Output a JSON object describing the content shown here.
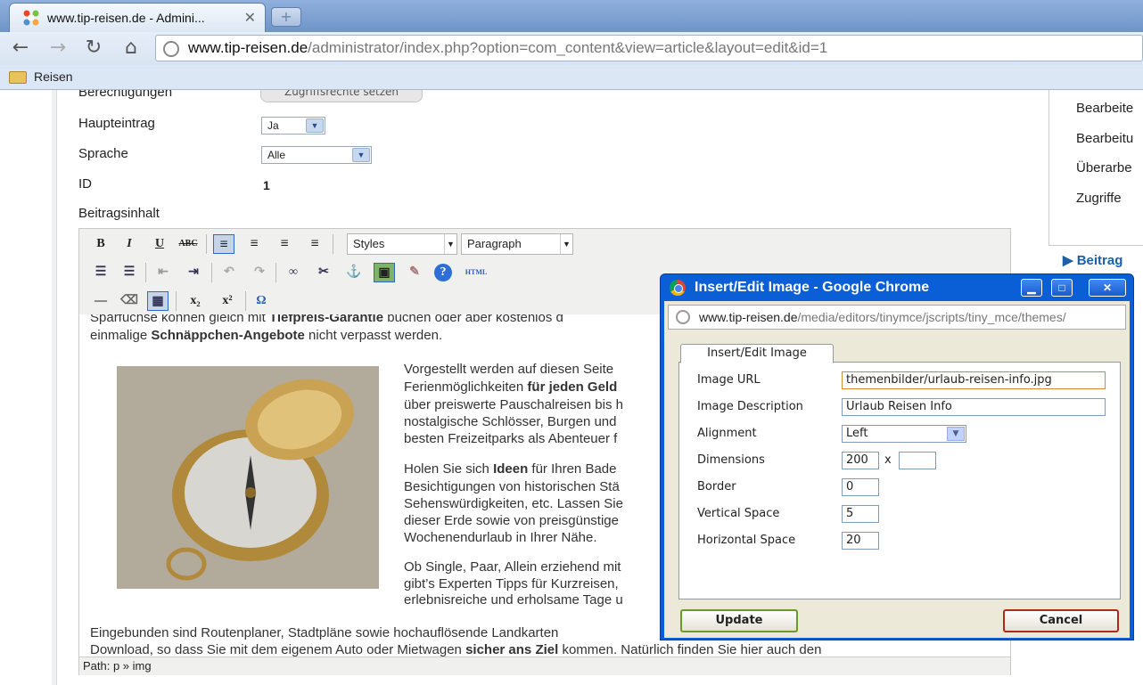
{
  "browser": {
    "tab_title": "www.tip-reisen.de - Admini...",
    "url_host": "www.tip-reisen.de",
    "url_path": "/administrator/index.php?option=com_content&view=article&layout=edit&id=1",
    "bookmark": "Reisen"
  },
  "form": {
    "permissions_label": "Berechtigungen",
    "permissions_button": "Zugriffsrechte setzen",
    "featured_label": "Haupteintrag",
    "featured_value": "Ja",
    "language_label": "Sprache",
    "language_value": "Alle",
    "id_label": "ID",
    "id_value": "1",
    "content_label": "Beitragsinhalt"
  },
  "editor": {
    "styles_select": "Styles",
    "format_select": "Paragraph",
    "html_button": "HTML",
    "path": "Path: p » img",
    "content": {
      "line1_a": "Sparfüchse können gleich mit ",
      "line1_b": "Tiefpreis-Garantie",
      "line1_c": " buchen oder aber kostenlos d",
      "line2_a": "einmalige ",
      "line2_b": "Schnäppchen-Angebote",
      "line2_c": " nicht verpasst werden.",
      "p1_1": "Vorgestellt werden auf diesen Seite",
      "p1_2a": "Ferienmöglichkeiten ",
      "p1_2b": "für jeden Geld",
      "p1_3": "über preiswerte Pauschalreisen bis h",
      "p1_4": "nostalgische Schlösser, Burgen und",
      "p1_5": "besten Freizeitparks als Abenteuer f",
      "p2_1a": "Holen Sie sich ",
      "p2_1b": "Ideen",
      "p2_1c": " für Ihren Bade",
      "p2_2": "Besichtigungen von historischen Stä",
      "p2_3": "Sehenswürdigkeiten, etc. Lassen Sie",
      "p2_4": "dieser Erde sowie von preisgünstige",
      "p2_5": "Wochenendurlaub in Ihrer Nähe.",
      "p3_1": "Ob Single, Paar, Allein erziehend mit",
      "p3_2": "gibt’s Experten Tipps für Kurzreisen,",
      "p3_3": "erlebnisreiche und erholsame Tage u",
      "p4_1": "Eingebunden sind Routenplaner, Stadtpläne sowie hochauflösende Landkarten",
      "p4_2a": "Download, so dass Sie mit dem eigenem Auto oder Mietwagen ",
      "p4_2b": "sicher ans Ziel",
      "p4_2c": " kommen. Natürlich finden Sie hier auch den"
    }
  },
  "right_column": {
    "items": [
      "Bearbeite",
      "Bearbeitu",
      "Überarbe",
      "Zugriffe"
    ],
    "section": "Beitrag"
  },
  "dialog": {
    "title": "Insert/Edit Image - Google Chrome",
    "url_host": "www.tip-reisen.de",
    "url_path": "/media/editors/tinymce/jscripts/tiny_mce/themes/",
    "tab": "Insert/Edit Image",
    "image_url_label": "Image URL",
    "image_url_value": "themenbilder/urlaub-reisen-info.jpg",
    "description_label": "Image Description",
    "description_value": "Urlaub Reisen Info",
    "alignment_label": "Alignment",
    "alignment_value": "Left",
    "dimensions_label": "Dimensions",
    "width_value": "200",
    "dim_separator": "x",
    "height_value": "",
    "border_label": "Border",
    "border_value": "0",
    "vspace_label": "Vertical Space",
    "vspace_value": "5",
    "hspace_label": "Horizontal Space",
    "hspace_value": "20",
    "update_button": "Update",
    "cancel_button": "Cancel"
  }
}
